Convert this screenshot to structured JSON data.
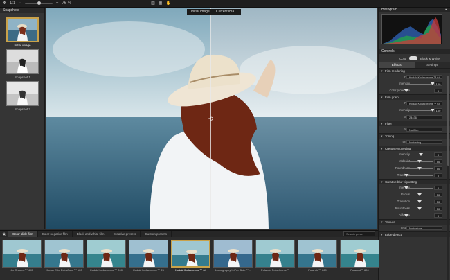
{
  "toolbar": {
    "zoom_label": "1:1",
    "zoom_value": "76 %"
  },
  "snapshots": {
    "header": "Snapshots",
    "items": [
      {
        "label": "Initial image"
      },
      {
        "label": "Snapshot 1"
      },
      {
        "label": "Snapshot 2"
      }
    ]
  },
  "compare": {
    "left_label": "Initial image",
    "right_label": "Current ima..."
  },
  "panel": {
    "histogram_title": "Histogram",
    "controls_title": "Controls",
    "color_label": "Color",
    "bw_label": "Black & White",
    "tabs": [
      "Effects",
      "Settings"
    ],
    "sections": [
      {
        "title": "Film rendering",
        "rows": [
          {
            "type": "dd",
            "label": "Film",
            "value": "Kodak Kodachrome™ 64"
          },
          {
            "type": "slider",
            "label": "Intensity",
            "value": "100",
            "level": 1.0
          },
          {
            "type": "slider",
            "label": "Color protection",
            "value": "0",
            "level": 0.0
          }
        ]
      },
      {
        "title": "Film grain",
        "rows": [
          {
            "type": "dd",
            "label": "Film",
            "value": "Kodak Kodachrome™ 64"
          },
          {
            "type": "slider",
            "label": "Intensity",
            "value": "100",
            "level": 1.0
          },
          {
            "type": "dd",
            "label": "Size",
            "value": "24x36"
          }
        ]
      },
      {
        "title": "Filter",
        "rows": [
          {
            "type": "dd",
            "label": "Filter",
            "value": "No filter"
          }
        ]
      },
      {
        "title": "Toning",
        "rows": [
          {
            "type": "dd",
            "label": "Toning",
            "value": "No toning"
          }
        ]
      },
      {
        "title": "Creative vignetting",
        "rows": [
          {
            "type": "slider",
            "label": "Intensity",
            "value": "0",
            "level": 0.55
          },
          {
            "type": "slider",
            "label": "Midpoint",
            "value": "50",
            "level": 0.5
          },
          {
            "type": "slider",
            "label": "Roundness",
            "value": "50",
            "level": 0.5
          },
          {
            "type": "slider",
            "label": "Transition",
            "value": "0",
            "level": 0.0
          }
        ]
      },
      {
        "title": "Creative blur vignetting",
        "rows": [
          {
            "type": "slider",
            "label": "Intensity",
            "value": "0",
            "level": 0.0
          },
          {
            "type": "slider",
            "label": "Radius",
            "value": "50",
            "level": 0.5
          },
          {
            "type": "slider",
            "label": "Transition",
            "value": "50",
            "level": 0.5
          },
          {
            "type": "slider",
            "label": "Roundness",
            "value": "50",
            "level": 0.5
          },
          {
            "type": "slider",
            "label": "Diffusion",
            "value": "0",
            "level": 0.0
          }
        ]
      },
      {
        "title": "Texture",
        "rows": [
          {
            "type": "dd",
            "label": "Texture",
            "value": "No texture"
          }
        ]
      },
      {
        "title": "Edge defect",
        "rows": []
      }
    ]
  },
  "presets": {
    "tabs": [
      "Color slide film",
      "Color negative film",
      "Black and white film",
      "Creative presets",
      "Custom presets"
    ],
    "search_placeholder": "Search preset",
    "items": [
      {
        "label": "Ax Chrome™ 400"
      },
      {
        "label": "Kodak Elite ExtraColor™ 100"
      },
      {
        "label": "Kodak Kodachrome™ 200"
      },
      {
        "label": "Kodak Kodachrome™ 25"
      },
      {
        "label": "Kodak Kodachrome™ 64"
      },
      {
        "label": "Lomography X-Pro Slide™..."
      },
      {
        "label": "Polaroid Polachrome™"
      },
      {
        "label": "Polaroid™ 669"
      },
      {
        "label": "Polaroid™ 690"
      }
    ]
  },
  "colors": {
    "accent": "#c9a24a",
    "bg": "#2e2e2e"
  }
}
